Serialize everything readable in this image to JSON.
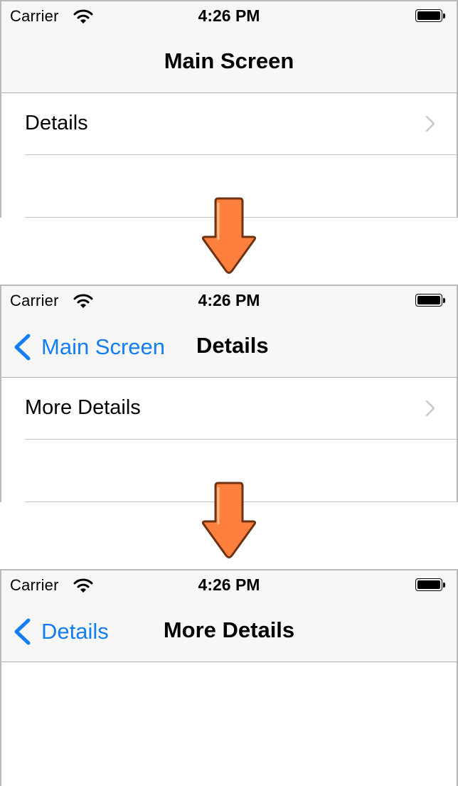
{
  "colors": {
    "tint": "#137ef4",
    "nav_bar_bg": "#f7f7f7",
    "arrow_fill": "#ff7f3f",
    "arrow_stroke": "#6b3312"
  },
  "screens": [
    {
      "status": {
        "carrier": "Carrier",
        "time": "4:26 PM"
      },
      "nav": {
        "back": "",
        "title": "Main Screen"
      },
      "rows": [
        {
          "label": "Details",
          "icon": "chevron-right-icon"
        }
      ]
    },
    {
      "status": {
        "carrier": "Carrier",
        "time": "4:26 PM"
      },
      "nav": {
        "back": "Main Screen",
        "title": "Details"
      },
      "rows": [
        {
          "label": "More Details",
          "icon": "chevron-right-icon"
        }
      ]
    },
    {
      "status": {
        "carrier": "Carrier",
        "time": "4:26 PM"
      },
      "nav": {
        "back": "Details",
        "title": "More Details"
      },
      "rows": []
    }
  ],
  "transitions": [
    {
      "icon": "arrow-down-icon"
    },
    {
      "icon": "arrow-down-icon"
    }
  ]
}
